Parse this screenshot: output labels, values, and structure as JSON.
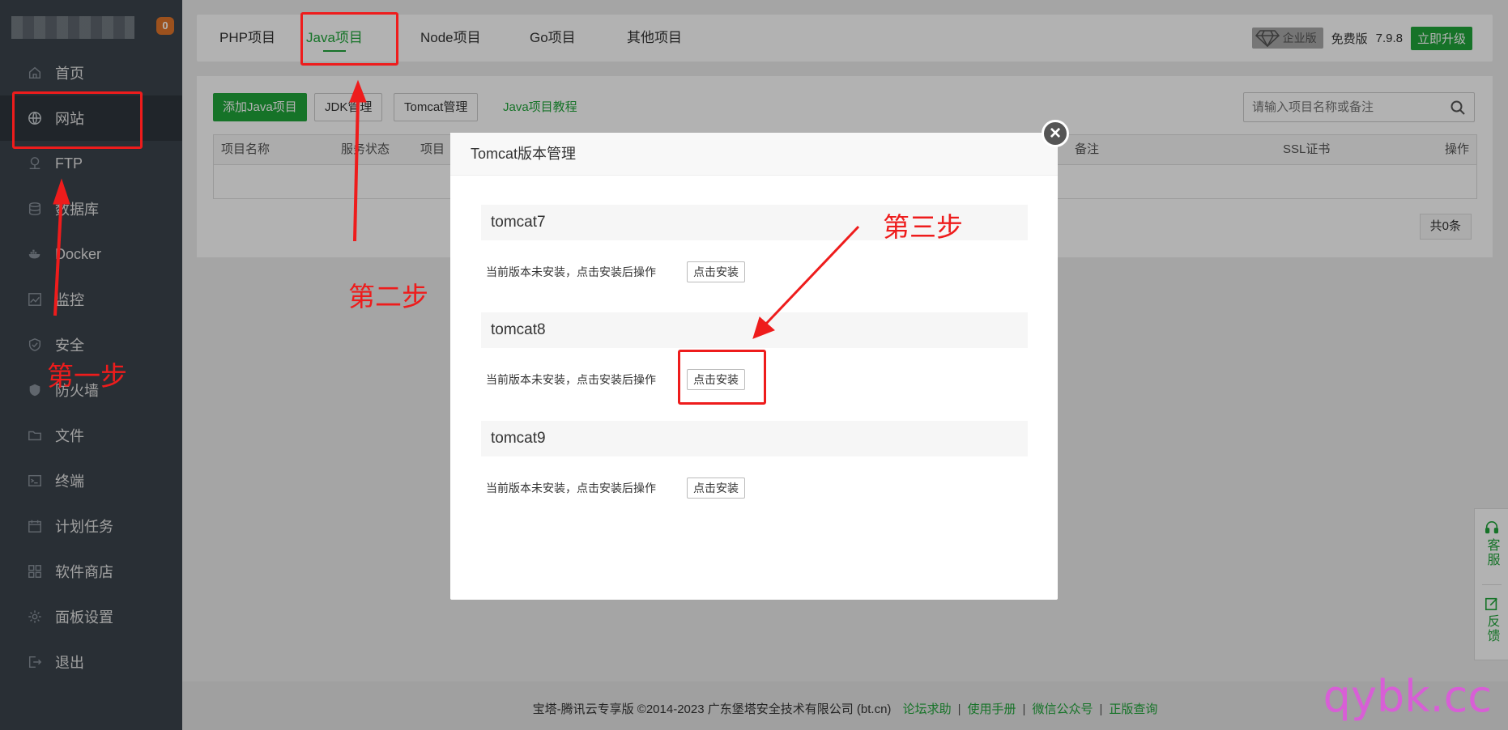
{
  "sidebar": {
    "badge": "0",
    "items": [
      {
        "label": "首页",
        "icon": "home-icon"
      },
      {
        "label": "网站",
        "icon": "globe-icon"
      },
      {
        "label": "FTP",
        "icon": "ftp-icon"
      },
      {
        "label": "数据库",
        "icon": "database-icon"
      },
      {
        "label": "Docker",
        "icon": "docker-icon"
      },
      {
        "label": "监控",
        "icon": "monitor-icon"
      },
      {
        "label": "安全",
        "icon": "shield-check-icon"
      },
      {
        "label": "防火墙",
        "icon": "firewall-shield-icon"
      },
      {
        "label": "文件",
        "icon": "folder-icon"
      },
      {
        "label": "终端",
        "icon": "terminal-icon"
      },
      {
        "label": "计划任务",
        "icon": "calendar-icon"
      },
      {
        "label": "软件商店",
        "icon": "grid-icon"
      },
      {
        "label": "面板设置",
        "icon": "gear-icon"
      },
      {
        "label": "退出",
        "icon": "logout-icon"
      }
    ]
  },
  "tabs": [
    "PHP项目",
    "Java项目",
    "Node项目",
    "Go项目",
    "其他项目"
  ],
  "version": {
    "enterprise": "企业版",
    "free": "免费版",
    "number": "7.9.8",
    "upgrade": "立即升级"
  },
  "toolbar": {
    "add": "添加Java项目",
    "jdk": "JDK管理",
    "tomcat": "Tomcat管理",
    "tutorial": "Java项目教程",
    "search_placeholder": "请输入项目名称或备注"
  },
  "table": {
    "headers": [
      "项目名称",
      "服务状态",
      "项目",
      "备注",
      "SSL证书",
      "操作"
    ],
    "count": "共0条"
  },
  "modal": {
    "title": "Tomcat版本管理",
    "versions": [
      {
        "name": "tomcat7",
        "desc": "当前版本未安装，点击安装后操作",
        "button": "点击安装"
      },
      {
        "name": "tomcat8",
        "desc": "当前版本未安装，点击安装后操作",
        "button": "点击安装"
      },
      {
        "name": "tomcat9",
        "desc": "当前版本未安装，点击安装后操作",
        "button": "点击安装"
      }
    ]
  },
  "footer": {
    "copyright": "宝塔-腾讯云专享版 ©2014-2023 广东堡塔安全技术有限公司 (bt.cn)",
    "links": [
      "论坛求助",
      "使用手册",
      "微信公众号",
      "正版查询"
    ],
    "separator": "|"
  },
  "float": {
    "service": "客服",
    "feedback": "反馈"
  },
  "annotations": {
    "step1": "第一步",
    "step2": "第二步",
    "step3": "第三步",
    "color": "#ee1c1c"
  },
  "watermark": "qybk.cc",
  "colors": {
    "accent": "#20a53a",
    "sidebar": "#3c444d"
  }
}
